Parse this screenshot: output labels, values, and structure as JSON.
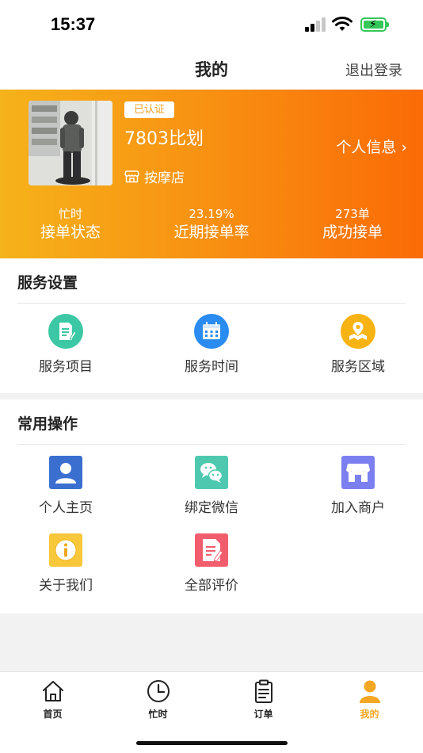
{
  "status_bar": {
    "time": "15:37"
  },
  "header": {
    "title": "我的",
    "logout": "退出登录"
  },
  "profile": {
    "badge": "已认证",
    "name": "7803比划",
    "info_link": "个人信息 ›",
    "shop_type": "按摩店",
    "stats": [
      {
        "value": "忙时",
        "label": "接单状态"
      },
      {
        "value": "23.19%",
        "label": "近期接单率"
      },
      {
        "value": "273单",
        "label": "成功接单"
      }
    ],
    "accent": "#f89012"
  },
  "service_settings": {
    "title": "服务设置",
    "items": [
      {
        "label": "服务项目",
        "icon": "service-items-icon",
        "color": "#3cc8a4"
      },
      {
        "label": "服务时间",
        "icon": "calendar-icon",
        "color": "#2a8cf0"
      },
      {
        "label": "服务区域",
        "icon": "map-location-icon",
        "color": "#f7b313"
      }
    ]
  },
  "common_ops": {
    "title": "常用操作",
    "items": [
      {
        "label": "个人主页",
        "icon": "user-profile-icon",
        "color": "#3a6fd0"
      },
      {
        "label": "绑定微信",
        "icon": "wechat-icon",
        "color": "#4ec9b0"
      },
      {
        "label": "加入商户",
        "icon": "store-icon",
        "color": "#7c7ff0"
      },
      {
        "label": "关于我们",
        "icon": "info-icon",
        "color": "#f8c83a"
      },
      {
        "label": "全部评价",
        "icon": "reviews-icon",
        "color": "#f25d6e"
      }
    ]
  },
  "tabbar": {
    "items": [
      {
        "label": "首页",
        "icon": "home-icon"
      },
      {
        "label": "忙时",
        "icon": "clock-icon"
      },
      {
        "label": "订单",
        "icon": "clipboard-icon"
      },
      {
        "label": "我的",
        "icon": "person-icon",
        "active": true
      }
    ],
    "active_color": "#f5a623"
  }
}
